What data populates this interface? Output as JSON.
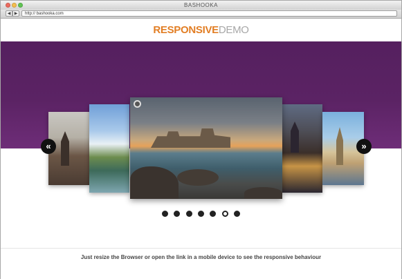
{
  "window": {
    "title": "BASHOOKA"
  },
  "toolbar": {
    "back_label": "◀",
    "forward_label": "▶",
    "url": "http:// bashooka.com"
  },
  "header": {
    "logo_part1": "RESPONSIVE",
    "logo_part2": "DEMO"
  },
  "colors": {
    "accent_orange": "#e27e24",
    "logo_gray": "#a7a7a7",
    "band_purple": "#55205f"
  },
  "carousel": {
    "slides": [
      {
        "name": "gothic-castle-slide"
      },
      {
        "name": "lake-tower-slide"
      },
      {
        "name": "sea-fortress-slide",
        "active": true
      },
      {
        "name": "illuminated-castle-slide"
      },
      {
        "name": "lake-church-slide"
      }
    ],
    "prev_label": "«",
    "next_label": "»",
    "pagination": {
      "count": 7,
      "active_index": 5
    }
  },
  "footer": {
    "text": "Just resize the Browser or open the link in a mobile device to see the responsive behaviour"
  }
}
